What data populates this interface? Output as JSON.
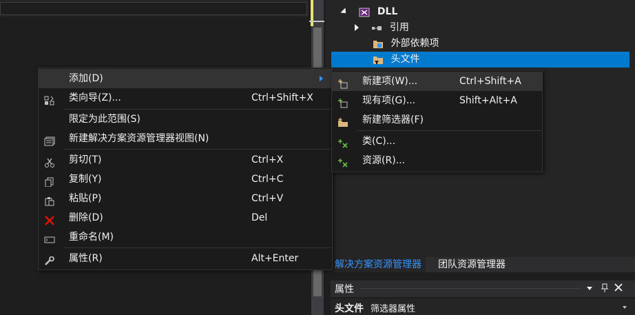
{
  "solution_explorer": {
    "project_name": "DLL",
    "items": [
      {
        "label": "引用"
      },
      {
        "label": "外部依赖项"
      },
      {
        "label": "头文件"
      }
    ],
    "tabs": [
      "解决方案资源管理器",
      "团队资源管理器"
    ]
  },
  "properties": {
    "title": "属性",
    "subject": "头文件",
    "subject_type": "筛选器属性"
  },
  "context_menu": {
    "items": [
      {
        "label": "添加(D)",
        "shortcut": ""
      },
      {
        "label": "类向导(Z)...",
        "shortcut": "Ctrl+Shift+X"
      },
      {
        "label": "限定为此范围(S)",
        "shortcut": ""
      },
      {
        "label": "新建解决方案资源管理器视图(N)",
        "shortcut": ""
      },
      {
        "label": "剪切(T)",
        "shortcut": "Ctrl+X"
      },
      {
        "label": "复制(Y)",
        "shortcut": "Ctrl+C"
      },
      {
        "label": "粘贴(P)",
        "shortcut": "Ctrl+V"
      },
      {
        "label": "删除(D)",
        "shortcut": "Del"
      },
      {
        "label": "重命名(M)",
        "shortcut": ""
      },
      {
        "label": "属性(R)",
        "shortcut": "Alt+Enter"
      }
    ]
  },
  "submenu": {
    "items": [
      {
        "label": "新建项(W)...",
        "shortcut": "Ctrl+Shift+A"
      },
      {
        "label": "现有项(G)...",
        "shortcut": "Shift+Alt+A"
      },
      {
        "label": "新建筛选器(F)",
        "shortcut": ""
      },
      {
        "label": "类(C)...",
        "shortcut": ""
      },
      {
        "label": "资源(R)...",
        "shortcut": ""
      }
    ]
  },
  "colors": {
    "accent": "#007acc",
    "delete_icon": "#e51400",
    "folder_icon": "#dcb67a"
  }
}
